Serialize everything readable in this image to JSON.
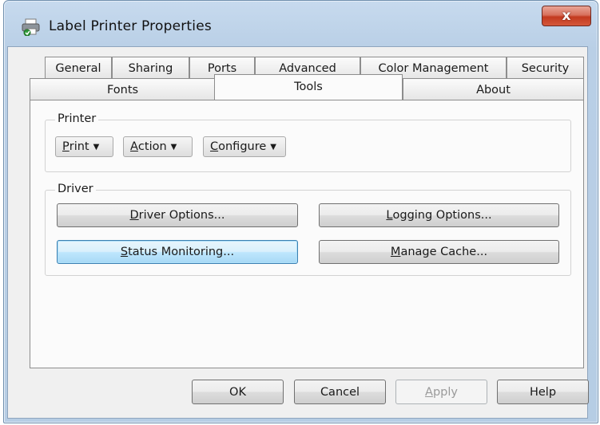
{
  "window": {
    "title": "Label Printer Properties",
    "close_label": "x",
    "icons": {
      "app": "printer-icon",
      "close": "close-icon"
    }
  },
  "tabs": {
    "row_top": [
      {
        "label": "General"
      },
      {
        "label": "Sharing"
      },
      {
        "label": "Ports"
      },
      {
        "label": "Advanced"
      },
      {
        "label": "Color Management"
      },
      {
        "label": "Security"
      }
    ],
    "row_bottom": [
      {
        "label": "Fonts"
      },
      {
        "label": "Tools",
        "active": true
      },
      {
        "label": "About"
      }
    ]
  },
  "printer_group": {
    "label": "Printer",
    "print_menu": {
      "mnemonic": "P",
      "rest": "rint"
    },
    "action_menu": {
      "mnemonic": "A",
      "rest": "ction"
    },
    "configure_menu": {
      "mnemonic": "C",
      "rest": "onfigure"
    },
    "dropdown_arrow": "▼"
  },
  "driver_group": {
    "label": "Driver",
    "driver_options": {
      "mnemonic": "D",
      "rest": "river Options..."
    },
    "logging_options": {
      "mnemonic": "L",
      "rest": "ogging Options..."
    },
    "status_monitoring": {
      "mnemonic": "S",
      "rest": "tatus Monitoring..."
    },
    "manage_cache": {
      "mnemonic": "M",
      "rest": "anage Cache..."
    }
  },
  "footer": {
    "ok": "OK",
    "cancel": "Cancel",
    "apply": {
      "mnemonic": "A",
      "rest": "pply"
    },
    "help": "Help"
  }
}
